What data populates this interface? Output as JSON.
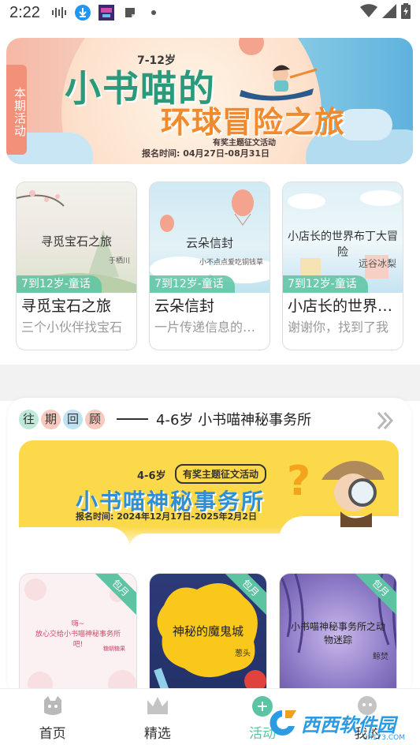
{
  "status_bar": {
    "time": "2:22"
  },
  "banner": {
    "tag": "本期活动",
    "age": "7-12岁",
    "title_line1": "小书喵的",
    "title_line2": "环球冒险之旅",
    "subtitle": "有奖主题征文活动",
    "date": "报名时间: 04月27日-08月31日"
  },
  "books": [
    {
      "cover_title": "寻觅宝石之旅",
      "cover_author": "于栖川",
      "age_tag": "7到12岁-童话",
      "title": "寻觅宝石之旅",
      "desc": "三个小伙伴找宝石"
    },
    {
      "cover_title": "云朵信封",
      "cover_author": "小不点点爱吃铜钱草",
      "age_tag": "7到12岁-童话",
      "title": "云朵信封",
      "desc": "一片传递信息的云朵"
    },
    {
      "cover_title": "小店长的世界布丁大冒险",
      "cover_author": "远谷冰梨",
      "age_tag": "7到12岁-童话",
      "title": "小店长的世界布丁大冒险",
      "desc": "谢谢你，找到了我"
    }
  ],
  "past": {
    "chars": [
      "往",
      "期",
      "回",
      "顾"
    ],
    "char_colors": [
      "#bfe8d9",
      "#f8c9bf",
      "#bfe3f2",
      "#f8c9bf"
    ],
    "title": "4-6岁 小书喵神秘事务所",
    "more": "»",
    "banner": {
      "age": "4-6岁",
      "badge": "有奖主题征文活动",
      "title": "小书喵神秘事务所",
      "date": "报名时间: 2024年12月17日-2025年2月2日",
      "question": "?"
    },
    "cards": [
      {
        "ribbon": "包月",
        "title": "嗨~\n放心交给小书喵神秘事务所吧!",
        "author": "糖朝糖果"
      },
      {
        "ribbon": "包月",
        "title": "神秘的魔鬼城",
        "author": "葱头"
      },
      {
        "ribbon": "包月",
        "title": "小书喵神秘事务所之动物迷踪",
        "author": "鲸焚"
      }
    ]
  },
  "nav": {
    "items": [
      {
        "label": "首页",
        "icon": "home-cat-icon"
      },
      {
        "label": "精选",
        "icon": "crown-icon"
      },
      {
        "label": "活动",
        "icon": "activity-icon"
      },
      {
        "label": "我的",
        "icon": "profile-icon"
      }
    ],
    "active_color": "#5cc4a2"
  },
  "watermark": {
    "text": "西西软件园",
    "sub": "CR173.COM"
  },
  "colors": {
    "accent": "#5cc4a2",
    "banner_tag": "#f39079"
  }
}
